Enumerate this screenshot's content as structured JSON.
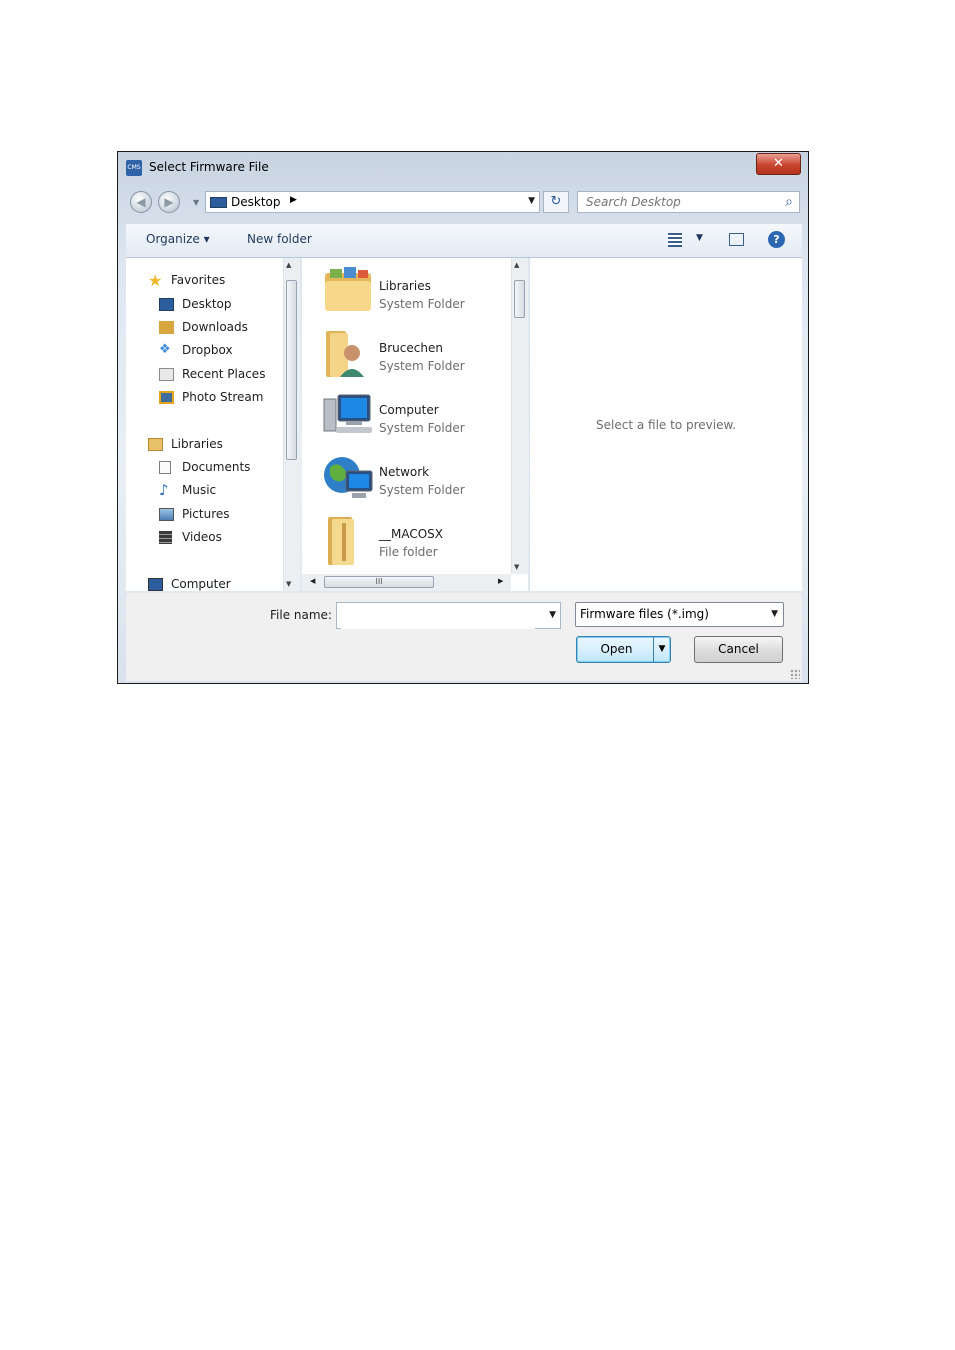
{
  "window": {
    "title": "Select Firmware File",
    "app_icon_text": "CMS",
    "close_glyph": "✕"
  },
  "navigation": {
    "back_glyph": "◀",
    "forward_glyph": "▶",
    "address_location": "Desktop",
    "address_separator": "▶",
    "dropdown_glyph": "▼",
    "refresh_glyph": "↻",
    "search_placeholder": "Search Desktop",
    "search_glyph": "⌕"
  },
  "toolbar": {
    "organize_label": "Organize ▾",
    "new_folder_label": "New folder",
    "views_caret": "▼",
    "help_glyph": "?"
  },
  "nav_pane": {
    "items": [
      {
        "label": "Favorites",
        "icon": "star-icon",
        "color": "#f0b92c"
      },
      {
        "label": "Desktop",
        "icon": "desktop-icon",
        "color": "#2c5e9e"
      },
      {
        "label": "Downloads",
        "icon": "downloads-icon",
        "color": "#d8a63e"
      },
      {
        "label": "Dropbox",
        "icon": "dropbox-icon",
        "color": "#3c8be0"
      },
      {
        "label": "Recent Places",
        "icon": "recent-places-icon",
        "color": "#8c8c8c"
      },
      {
        "label": "Photo Stream",
        "icon": "photo-stream-icon",
        "color": "#e6a21a"
      },
      {
        "label": "Libraries",
        "icon": "libraries-icon",
        "color": "#e8c068"
      },
      {
        "label": "Documents",
        "icon": "documents-icon",
        "color": "#e5e5e5"
      },
      {
        "label": "Music",
        "icon": "music-icon",
        "color": "#2f6fc0"
      },
      {
        "label": "Pictures",
        "icon": "pictures-icon",
        "color": "#4d7fb4"
      },
      {
        "label": "Videos",
        "icon": "videos-icon",
        "color": "#3a3a3a"
      },
      {
        "label": "Computer",
        "icon": "computer-icon",
        "color": "#2c5e9e"
      }
    ]
  },
  "file_list": {
    "items": [
      {
        "name": "Libraries",
        "type": "System Folder",
        "icon": "libraries-folder-icon"
      },
      {
        "name": "Brucechen",
        "type": "System Folder",
        "icon": "user-folder-icon"
      },
      {
        "name": "Computer",
        "type": "System Folder",
        "icon": "computer-icon"
      },
      {
        "name": "Network",
        "type": "System Folder",
        "icon": "network-icon"
      },
      {
        "name": "__MACOSX",
        "type": "File folder",
        "icon": "folder-icon"
      }
    ],
    "hscroll_thumb_label": "III"
  },
  "preview": {
    "message": "Select a file to preview."
  },
  "footer": {
    "file_name_label": "File name:",
    "file_name_value": "",
    "filter_value": "Firmware files (*.img)",
    "open_label": "Open",
    "cancel_label": "Cancel"
  },
  "colors": {
    "close_button": "#c7442f",
    "accent": "#2c5e9e",
    "open_button_border": "#3c7fb1"
  }
}
